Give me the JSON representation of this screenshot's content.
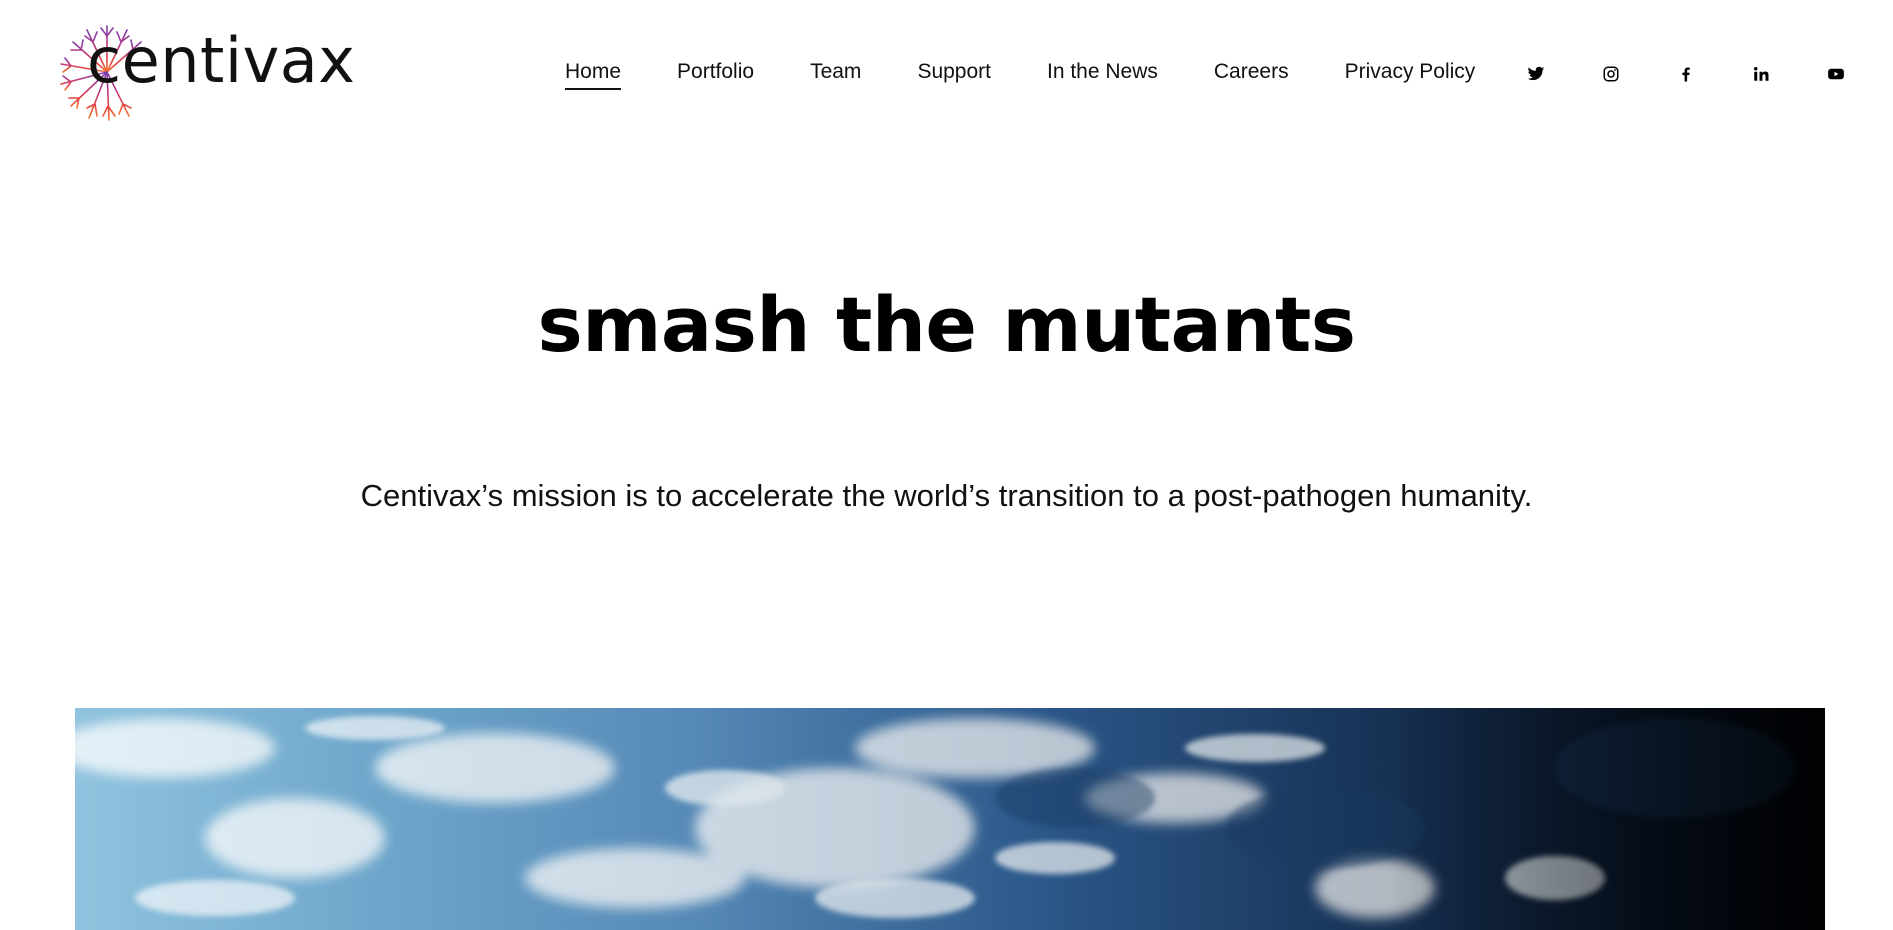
{
  "brand": {
    "name": "centivax",
    "accent_colors": [
      "#7b3fb0",
      "#c0397a",
      "#e8453c",
      "#f07a3a"
    ]
  },
  "nav": {
    "items": [
      {
        "label": "Home",
        "active": true
      },
      {
        "label": "Portfolio",
        "active": false
      },
      {
        "label": "Team",
        "active": false
      },
      {
        "label": "Support",
        "active": false
      },
      {
        "label": "In the News",
        "active": false
      },
      {
        "label": "Careers",
        "active": false
      },
      {
        "label": "Privacy Policy",
        "active": false
      }
    ]
  },
  "social": {
    "icons": [
      "twitter-icon",
      "instagram-icon",
      "facebook-icon",
      "linkedin-icon",
      "youtube-icon"
    ]
  },
  "hero": {
    "title": "smash the mutants",
    "subtitle": "Centivax’s mission is to accelerate the world’s transition to a post-pathogen humanity."
  },
  "banner": {
    "description_icon": "earth-from-space-image"
  }
}
